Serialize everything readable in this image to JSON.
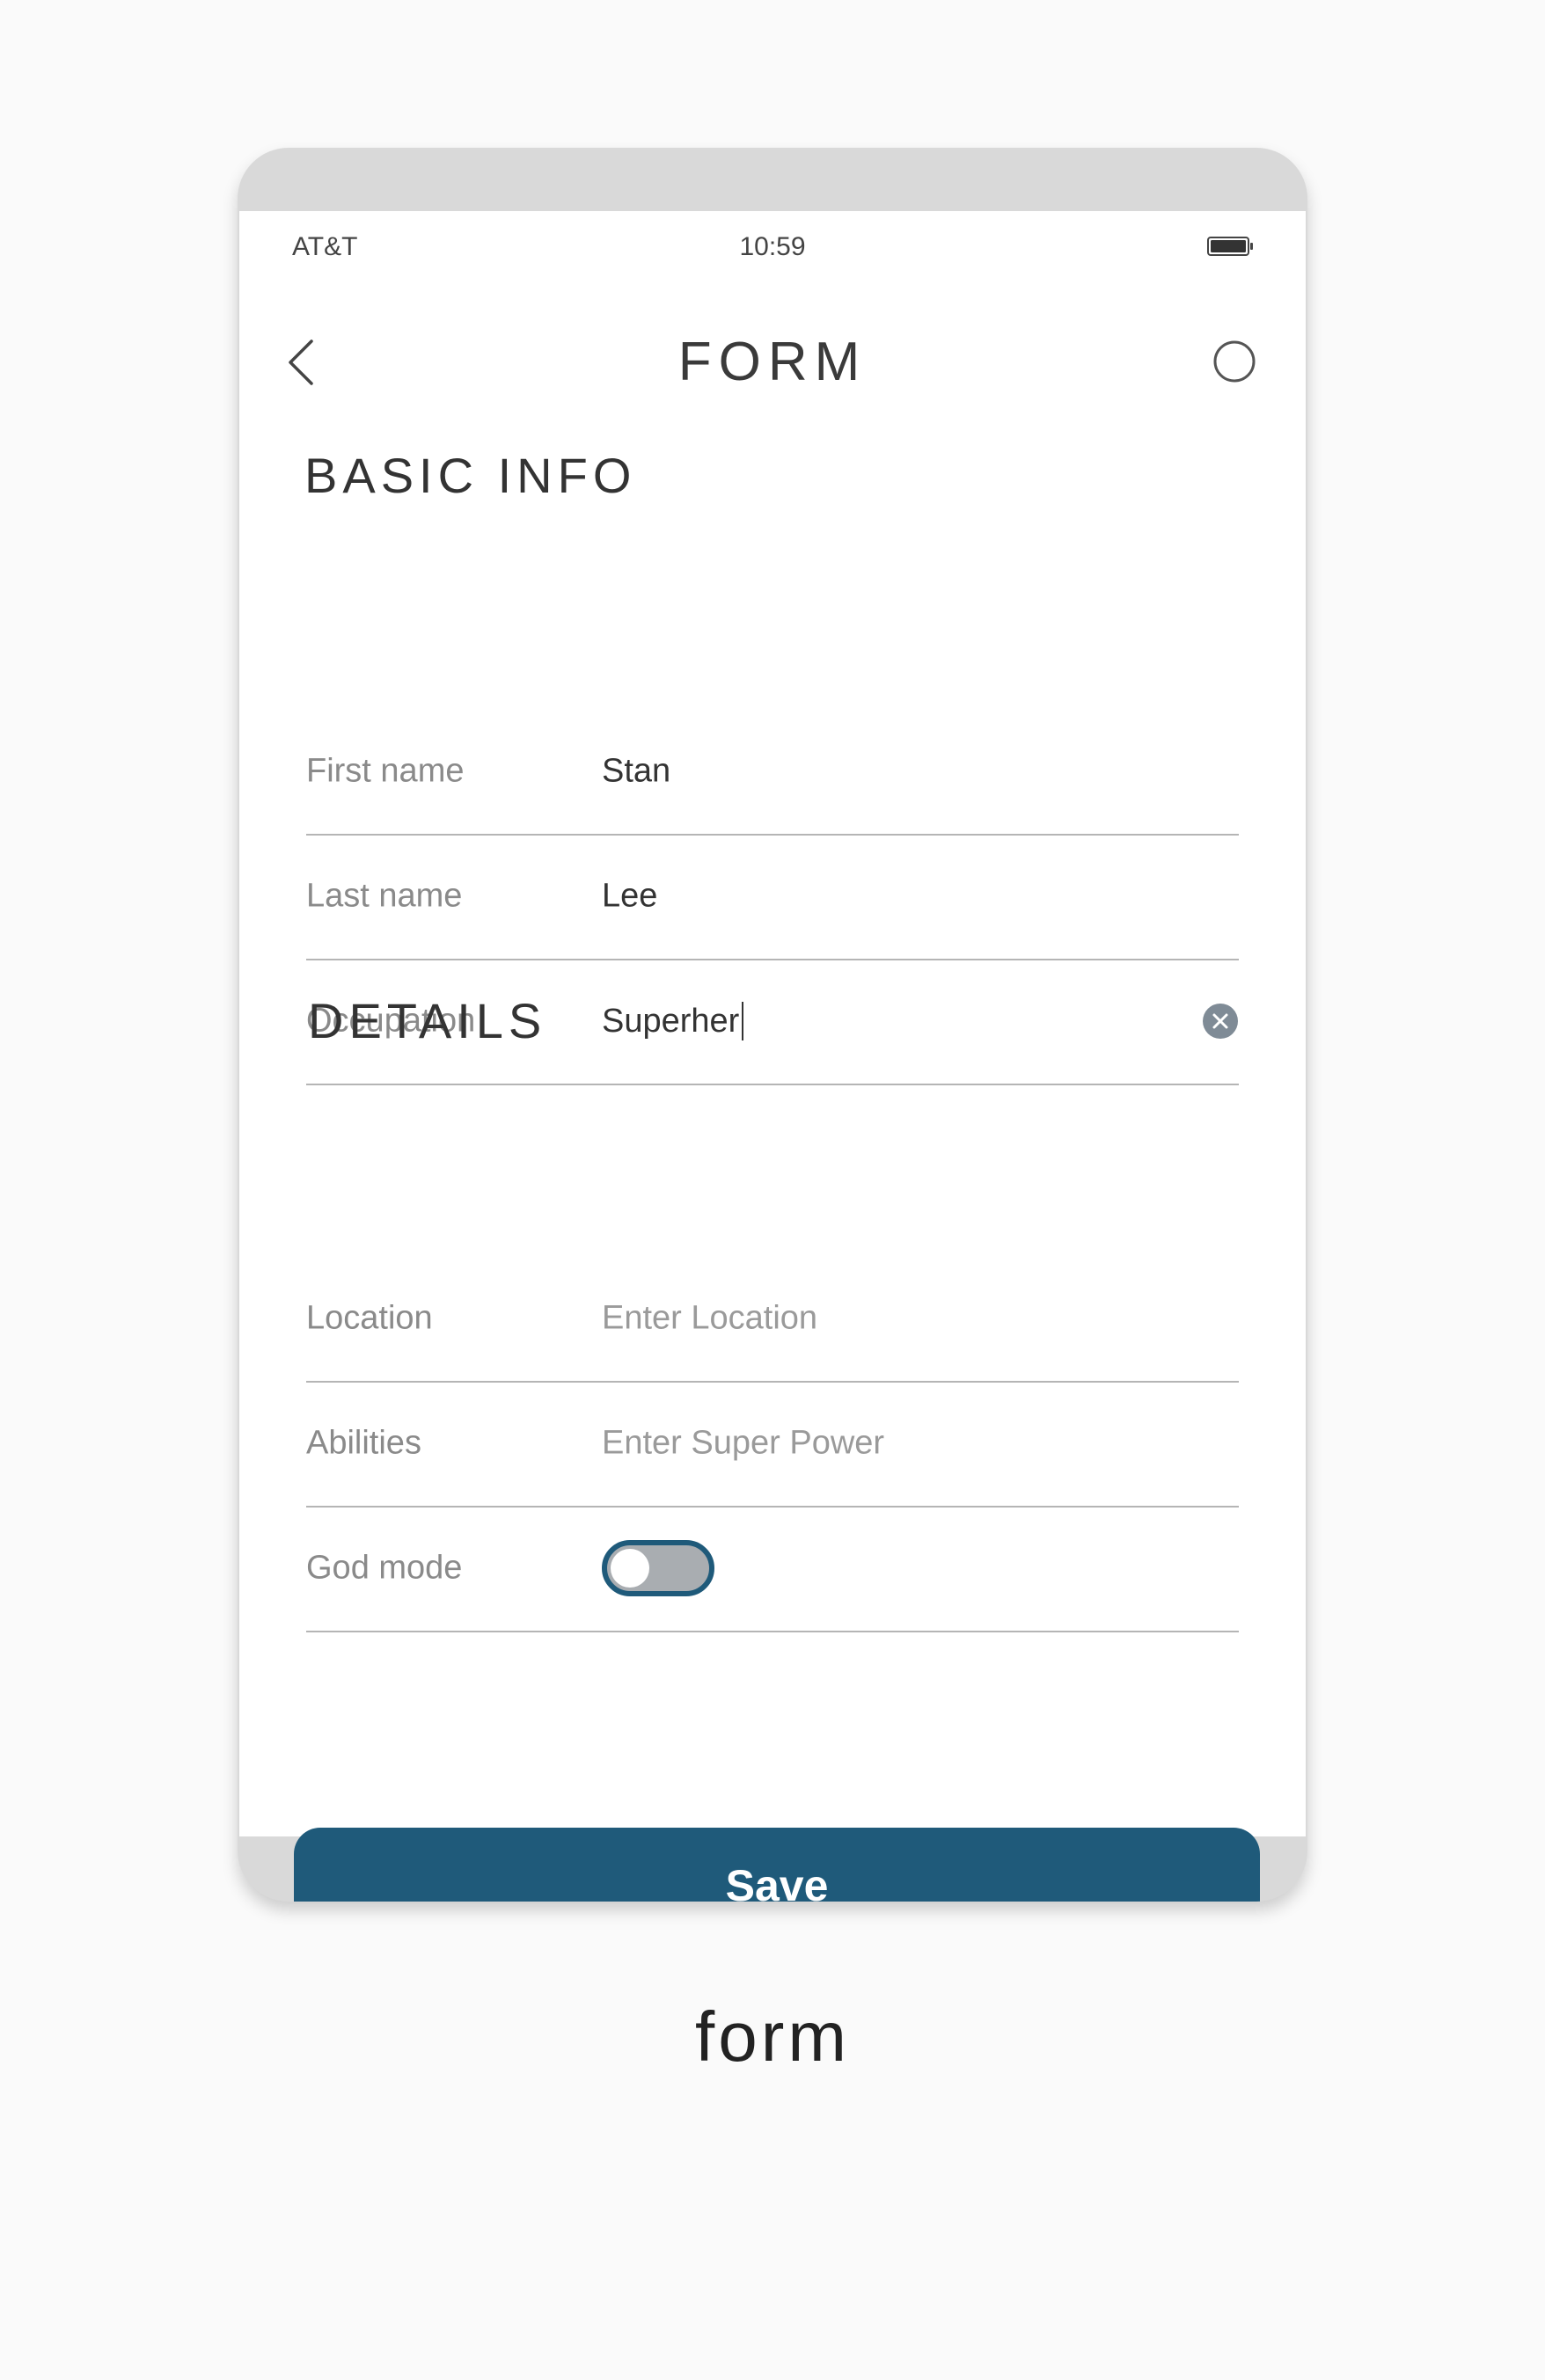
{
  "status_bar": {
    "carrier": "AT&T",
    "time": "10:59",
    "battery_icon": "battery-icon"
  },
  "nav": {
    "back_icon": "chevron-left-icon",
    "title": "FORM",
    "action_icon": "circle-icon"
  },
  "basic_info": {
    "title": "BASIC INFO",
    "rows": [
      {
        "label": "First name",
        "value": "Stan"
      },
      {
        "label": "Last name",
        "value": "Lee"
      },
      {
        "label": "Occupation",
        "value": "Superher"
      }
    ],
    "clear_icon": "clear-icon"
  },
  "details": {
    "title": "DETAILS",
    "location": {
      "label": "Location",
      "placeholder": "Enter Location"
    },
    "abilities": {
      "label": "Abilities",
      "placeholder": "Enter Super Power"
    },
    "god_mode": {
      "label": "God mode",
      "enabled": false
    }
  },
  "save_label": "Save",
  "caption": "form",
  "colors": {
    "accent": "#1f5a7a",
    "device_frame": "#d9d9d9",
    "background": "#fafafa",
    "toggle_track": "#a9adb1",
    "clear_icon": "#7f8b96"
  }
}
